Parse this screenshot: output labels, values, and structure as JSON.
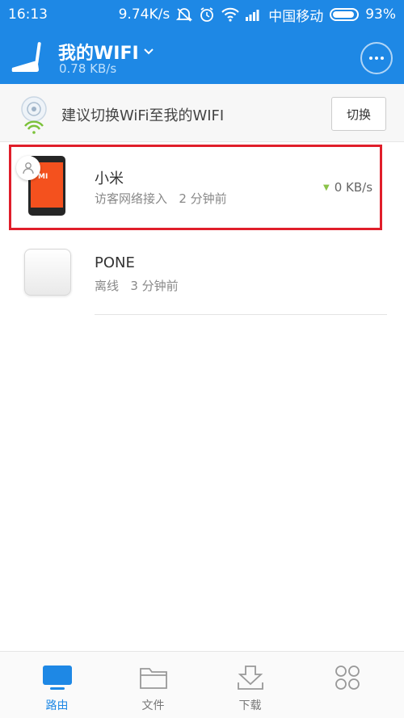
{
  "status_bar": {
    "time": "16:13",
    "net_speed": "9.74K/s",
    "carrier": "中国移动",
    "battery_percent": "93%",
    "battery_level": 0.93,
    "icons": [
      "silent-icon",
      "alarm-icon",
      "wifi-icon",
      "signal-icon",
      "battery-icon"
    ]
  },
  "header": {
    "title": "我的WIFI",
    "speed": "0.78 KB/s",
    "icons": [
      "router-icon",
      "chevron-down-icon",
      "more-icon"
    ]
  },
  "suggestion": {
    "text": "建议切换WiFi至我的WIFI",
    "button_label": "切换",
    "icon": "wifi-disc-icon"
  },
  "devices": [
    {
      "name": "小米",
      "status": "访客网络接入",
      "time": "2 分钟前",
      "rate": "0 KB/s",
      "icon": "phone-icon",
      "badge_icon": "guest-user-icon",
      "phone_brand_text": "MI"
    },
    {
      "name": "PONE",
      "status": "离线",
      "time": "3 分钟前",
      "icon": "device-box-icon"
    }
  ],
  "bottom_nav": [
    {
      "label": "路由",
      "icon": "router-tv-icon",
      "active": true
    },
    {
      "label": "文件",
      "icon": "folder-icon",
      "active": false
    },
    {
      "label": "下载",
      "icon": "download-icon",
      "active": false
    },
    {
      "label": "",
      "icon": "apps-icon",
      "active": false
    }
  ],
  "colors": {
    "primary": "#1e88e5",
    "highlight_border": "#e01e2a",
    "phone_orange": "#f4511e",
    "rate_arrow": "#8bc34a"
  }
}
